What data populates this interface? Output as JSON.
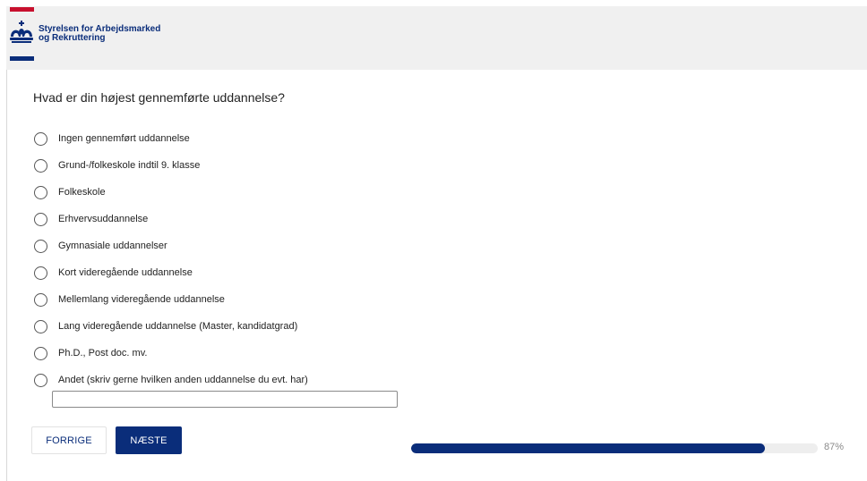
{
  "header": {
    "logo_line1": "Styrelsen for Arbejdsmarked",
    "logo_line2": "og Rekruttering",
    "logo_icon": "crown-icon"
  },
  "survey": {
    "question": "Hvad er din højest gennemførte uddannelse?",
    "options": [
      {
        "label": "Ingen gennemført uddannelse",
        "selected": false
      },
      {
        "label": "Grund-/folkeskole indtil 9. klasse",
        "selected": false
      },
      {
        "label": "Folkeskole",
        "selected": false
      },
      {
        "label": "Erhvervsuddannelse",
        "selected": false
      },
      {
        "label": "Gymnasiale uddannelser",
        "selected": false
      },
      {
        "label": "Kort videregående uddannelse",
        "selected": false
      },
      {
        "label": "Mellemlang videregående uddannelse",
        "selected": false
      },
      {
        "label": "Lang videregående uddannelse (Master, kandidatgrad)",
        "selected": false
      },
      {
        "label": "Ph.D., Post doc. mv.",
        "selected": false
      },
      {
        "label": "Andet (skriv gerne hvilken anden uddannelse du evt. har)",
        "selected": false
      }
    ],
    "other_input_value": "",
    "other_input_placeholder": ""
  },
  "navigation": {
    "prev_label": "FORRIGE",
    "next_label": "NÆSTE"
  },
  "progress": {
    "percent": 87,
    "label": "87%"
  },
  "colors": {
    "brand_blue": "#0a2d7a",
    "brand_red": "#c8102e",
    "header_bg": "#f0f0f0"
  }
}
